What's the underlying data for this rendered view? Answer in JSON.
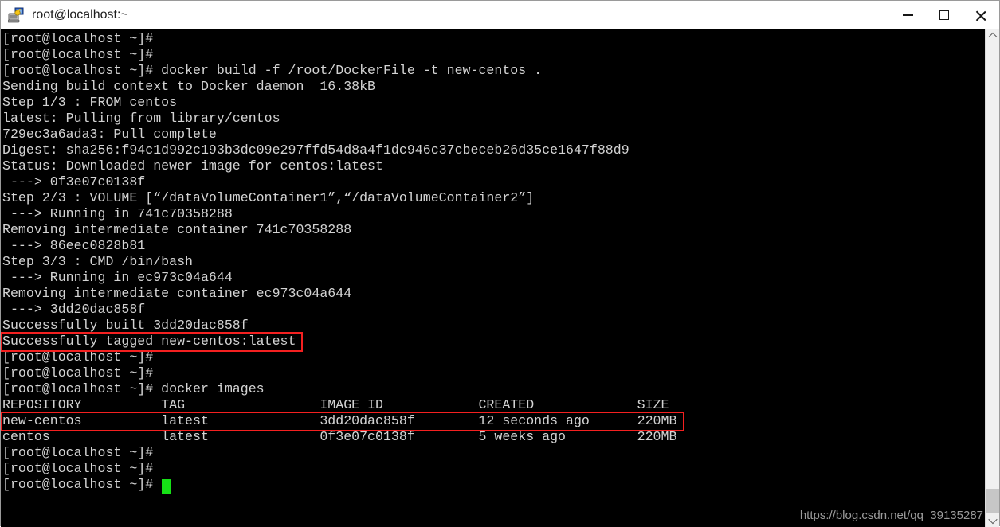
{
  "window": {
    "title": "root@localhost:~",
    "icon": "putty-computer-icon",
    "controls": {
      "minimize_label": "Minimize",
      "maximize_label": "Maximize",
      "close_label": "Close"
    }
  },
  "terminal": {
    "prompt": "[root@localhost ~]#",
    "foreground_color": "#d3d3d3",
    "background_color": "#000000",
    "cursor_color": "#16e016",
    "lines": [
      "[root@localhost ~]#",
      "[root@localhost ~]#",
      "[root@localhost ~]# docker build -f /root/DockerFile -t new-centos .",
      "Sending build context to Docker daemon  16.38kB",
      "Step 1/3 : FROM centos",
      "latest: Pulling from library/centos",
      "729ec3a6ada3: Pull complete",
      "Digest: sha256:f94c1d992c193b3dc09e297ffd54d8a4f1dc946c37cbeceb26d35ce1647f88d9",
      "Status: Downloaded newer image for centos:latest",
      " ---> 0f3e07c0138f",
      "Step 2/3 : VOLUME [“/dataVolumeContainer1”,“/dataVolumeContainer2”]",
      " ---> Running in 741c70358288",
      "Removing intermediate container 741c70358288",
      " ---> 86eec0828b81",
      "Step 3/3 : CMD /bin/bash",
      " ---> Running in ec973c04a644",
      "Removing intermediate container ec973c04a644",
      " ---> 3dd20dac858f",
      "Successfully built 3dd20dac858f",
      "Successfully tagged new-centos:latest",
      "[root@localhost ~]#",
      "[root@localhost ~]#",
      "[root@localhost ~]# docker images",
      "REPOSITORY          TAG                 IMAGE ID            CREATED             SIZE",
      "new-centos          latest              3dd20dac858f        12 seconds ago      220MB",
      "centos              latest              0f3e07c0138f        5 weeks ago         220MB",
      "[root@localhost ~]#",
      "[root@localhost ~]#",
      "[root@localhost ~]# "
    ],
    "images_table": {
      "columns": [
        "REPOSITORY",
        "TAG",
        "IMAGE ID",
        "CREATED",
        "SIZE"
      ],
      "rows": [
        [
          "new-centos",
          "latest",
          "3dd20dac858f",
          "12 seconds ago",
          "220MB"
        ],
        [
          "centos",
          "latest",
          "0f3e07c0138f",
          "5 weeks ago",
          "220MB"
        ]
      ]
    }
  },
  "annotations": {
    "color": "#f42020",
    "boxes": [
      {
        "name": "successfully-tagged-highlight",
        "label": "Successfully tagged new-centos:latest"
      },
      {
        "name": "new-centos-row-highlight",
        "label": "new-centos          latest              3dd20dac858f        12 seconds ago      220MB"
      }
    ]
  },
  "watermark": {
    "text": "https://blog.csdn.net/qq_39135287"
  },
  "scrollbar": {
    "up_arrow": "chevron-up-icon",
    "down_arrow": "chevron-down-icon"
  }
}
